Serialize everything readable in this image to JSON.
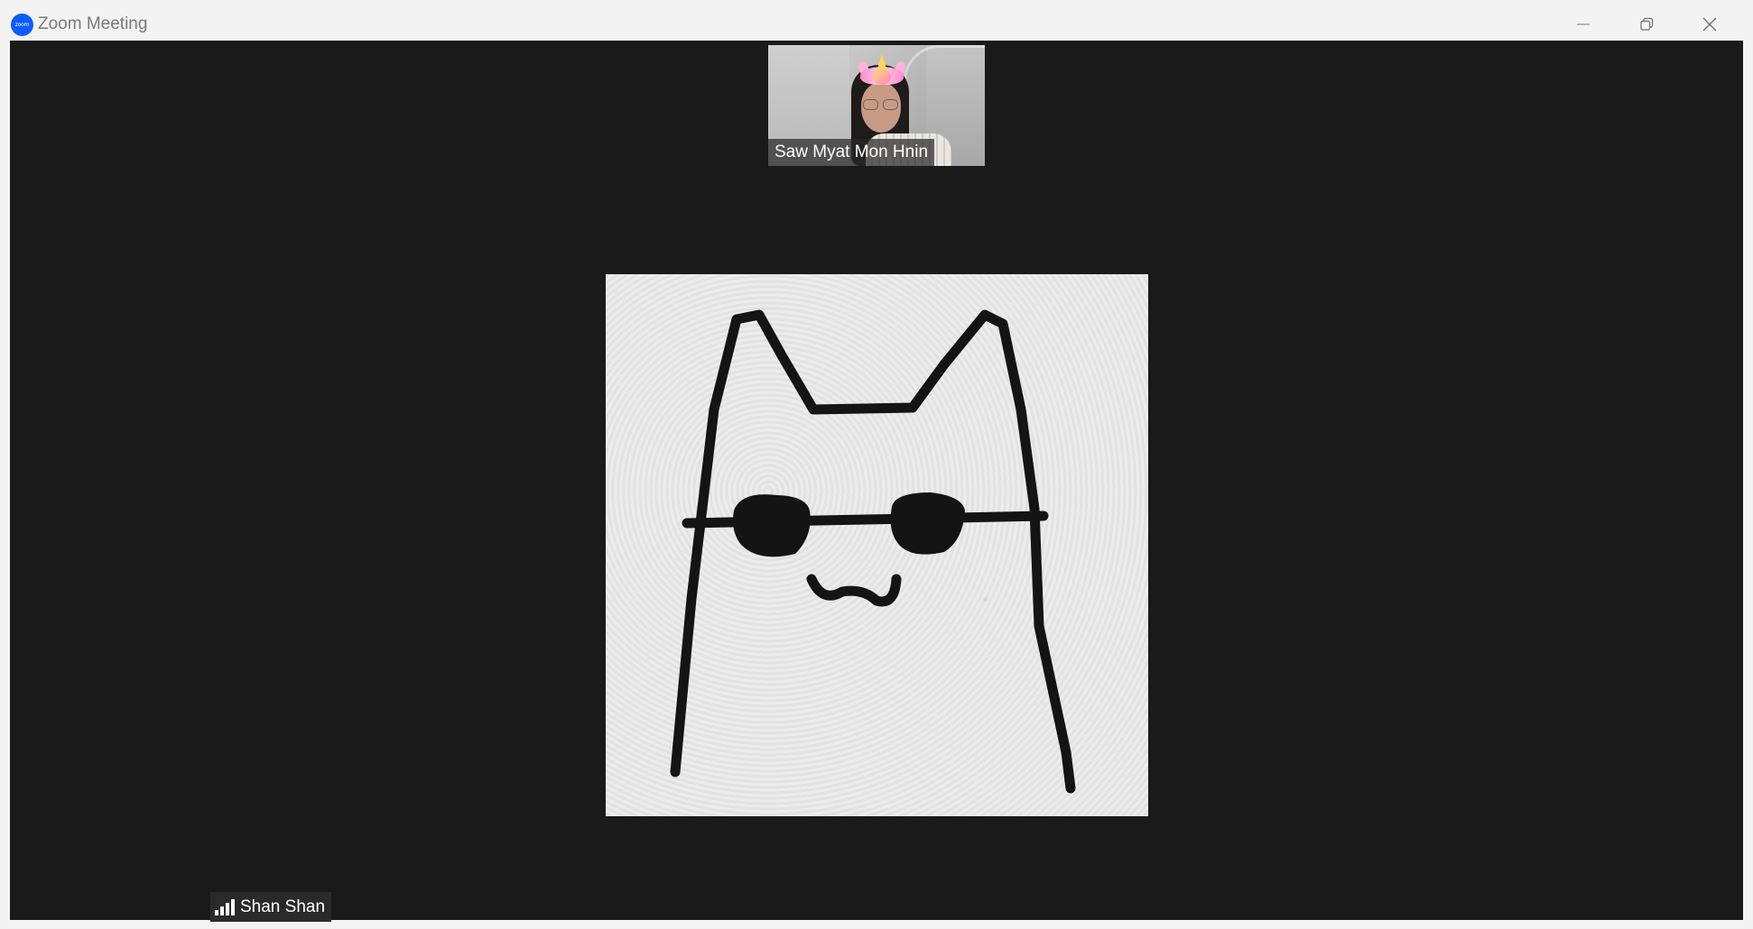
{
  "window": {
    "title": "Zoom Meeting",
    "logo_text": "zoom",
    "controls": {
      "minimize": "minimize-icon",
      "restore": "restore-icon",
      "close": "close-icon"
    }
  },
  "participants": {
    "thumbnail": {
      "name": "Saw Myat Mon Hnin"
    },
    "active_speaker": {
      "name": "Shan Shan",
      "signal_icon": "signal-bars-icon"
    }
  },
  "colors": {
    "title_bar": "#f3f3f3",
    "meeting_background": "#1a1a1a",
    "zoom_blue": "#0b5cff"
  }
}
